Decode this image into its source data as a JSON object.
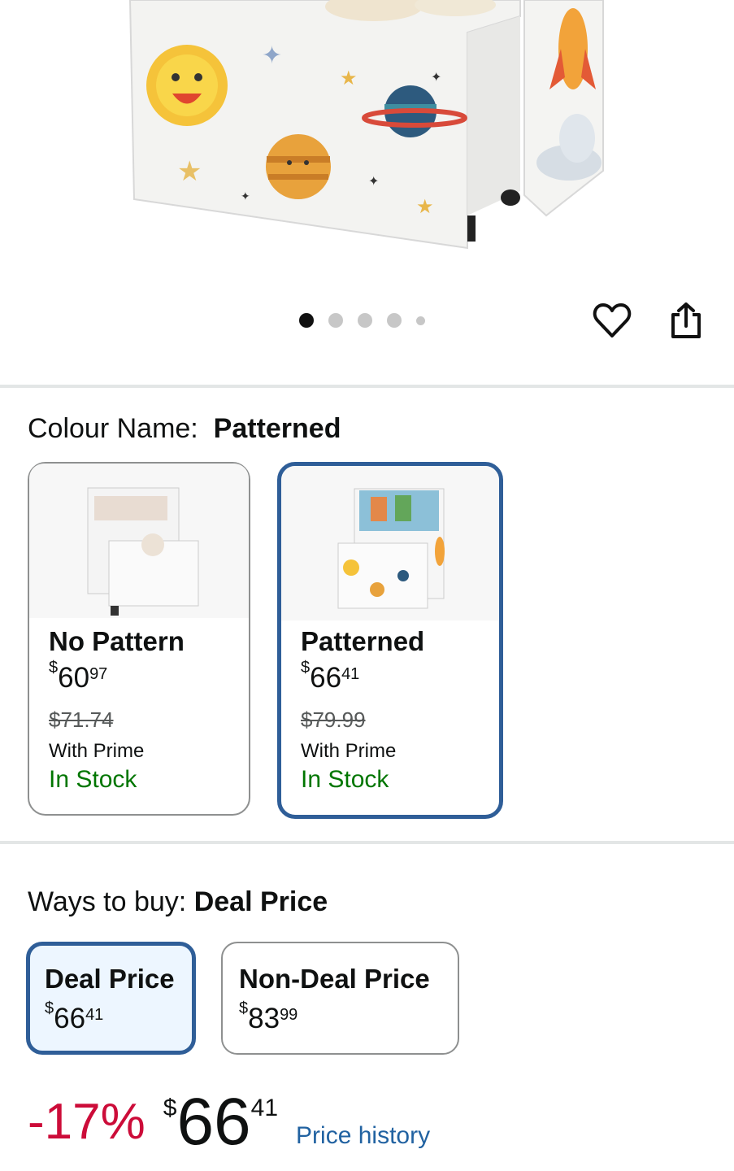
{
  "gallery": {
    "image_count": 5,
    "active_index": 0
  },
  "actions": {
    "wishlist_icon": "heart-icon",
    "share_icon": "share-icon"
  },
  "colour": {
    "label": "Colour Name:",
    "selected": "Patterned",
    "options": [
      {
        "name": "No Pattern",
        "price_symbol": "$",
        "price_whole": "60",
        "price_cents": "97",
        "list_price": "$71.74",
        "prime": "With Prime",
        "stock": "In Stock"
      },
      {
        "name": "Patterned",
        "price_symbol": "$",
        "price_whole": "66",
        "price_cents": "41",
        "list_price": "$79.99",
        "prime": "With Prime",
        "stock": "In Stock"
      }
    ]
  },
  "ways_to_buy": {
    "label": "Ways to buy:",
    "selected": "Deal Price",
    "options": [
      {
        "name": "Deal Price",
        "price_symbol": "$",
        "price_whole": "66",
        "price_cents": "41"
      },
      {
        "name": "Non-Deal Price",
        "price_symbol": "$",
        "price_whole": "83",
        "price_cents": "99"
      }
    ]
  },
  "price_summary": {
    "discount": "-17%",
    "symbol": "$",
    "whole": "66",
    "cents": "41",
    "history_link": "Price history"
  },
  "colors": {
    "accent": "#2f5e98",
    "discount": "#cc0c39",
    "in_stock": "#007600",
    "link": "#2162a1"
  }
}
